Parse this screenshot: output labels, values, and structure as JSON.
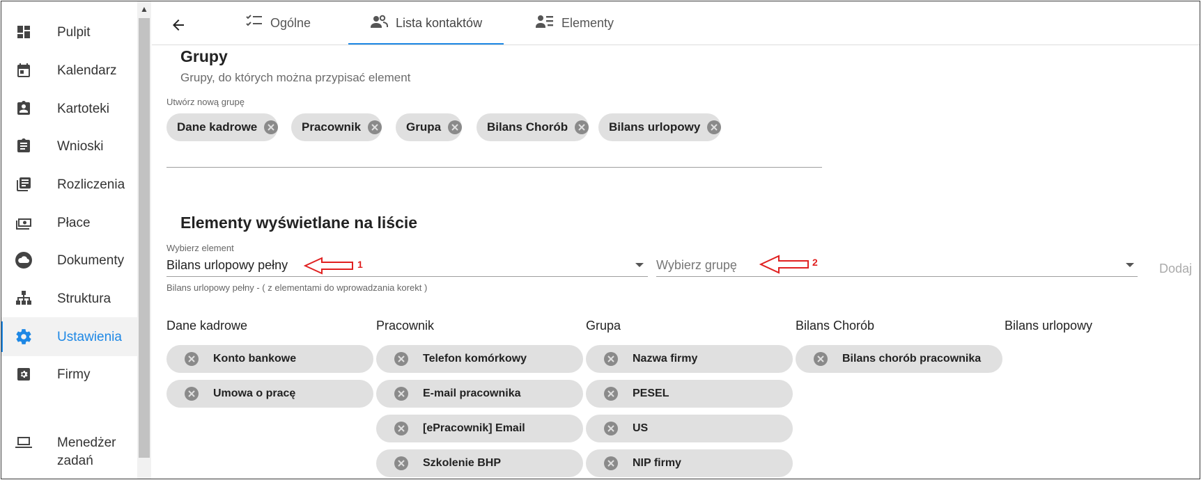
{
  "sidebar": {
    "items": [
      {
        "label": "Pulpit",
        "icon": "dashboard-icon"
      },
      {
        "label": "Kalendarz",
        "icon": "calendar-icon"
      },
      {
        "label": "Kartoteki",
        "icon": "badge-icon"
      },
      {
        "label": "Wnioski",
        "icon": "clipboard-icon"
      },
      {
        "label": "Rozliczenia",
        "icon": "library-books-icon"
      },
      {
        "label": "Płace",
        "icon": "money-icon"
      },
      {
        "label": "Dokumenty",
        "icon": "cloud-icon"
      },
      {
        "label": "Struktura",
        "icon": "hierarchy-icon"
      },
      {
        "label": "Ustawienia",
        "icon": "gear-icon",
        "active": true
      },
      {
        "label": "Firmy",
        "icon": "settings-box-icon"
      },
      {
        "label": "Menedżer zadań",
        "line1": "Menedżer",
        "line2": "zadań",
        "icon": "laptop-icon"
      }
    ]
  },
  "tabs": [
    {
      "label": "Ogólne",
      "icon": "checklist-icon"
    },
    {
      "label": "Lista kontaktów",
      "icon": "contacts-icon",
      "active": true
    },
    {
      "label": "Elementy",
      "icon": "contact-list-icon"
    }
  ],
  "groups": {
    "title": "Grupy",
    "subtitle": "Grupy, do których można przypisać element",
    "create_label": "Utwórz nową grupę",
    "chips": [
      "Dane kadrowe",
      "Pracownik",
      "Grupa",
      "Bilans Chorób",
      "Bilans urlopowy"
    ]
  },
  "elements": {
    "title": "Elementy wyświetlane na liście",
    "select_label": "Wybierz element",
    "select_value": "Bilans urlopowy pełny",
    "group_placeholder": "Wybierz grupę",
    "add_label": "Dodaj",
    "hint": "Bilans urlopowy pełny - ( z elementami do wprowadzania korekt )",
    "annotation_1": "1",
    "annotation_2": "2",
    "columns": [
      {
        "header": "Dane kadrowe",
        "items": [
          "Konto bankowe",
          "Umowa o pracę"
        ]
      },
      {
        "header": "Pracownik",
        "items": [
          "Telefon komórkowy",
          "E-mail pracownika",
          "[ePracownik] Email",
          "Szkolenie BHP"
        ]
      },
      {
        "header": "Grupa",
        "items": [
          "Nazwa firmy",
          "PESEL",
          "US",
          "NIP firmy"
        ]
      },
      {
        "header": "Bilans Chorób",
        "items": [
          "Bilans chorób pracownika"
        ]
      },
      {
        "header": "Bilans urlopowy",
        "items": []
      }
    ]
  },
  "colors": {
    "accent": "#1e88e5",
    "chip_bg": "#e0e0e0",
    "annotation": "#e02020"
  }
}
